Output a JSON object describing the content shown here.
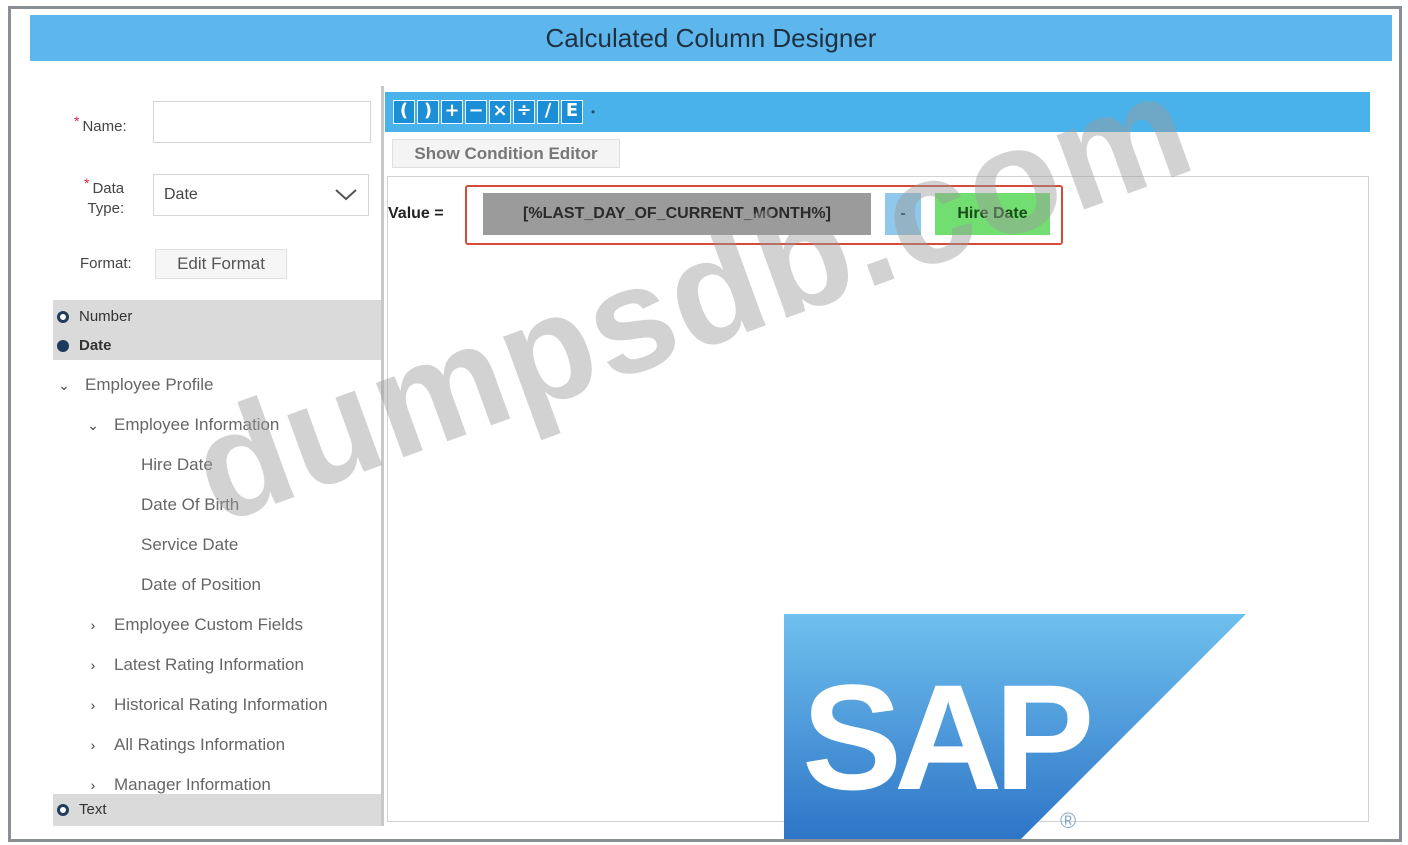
{
  "header": {
    "title": "Calculated Column Designer"
  },
  "form": {
    "name_label": "Name:",
    "data_type_label_1": "Data",
    "data_type_label_2": "Type:",
    "data_type_value": "Date",
    "format_label": "Format:",
    "edit_format_label": "Edit Format",
    "required_marker": "*"
  },
  "tree": {
    "radio_number": "Number",
    "radio_date": "Date",
    "radio_text": "Text",
    "employee_profile": "Employee Profile",
    "employee_information": "Employee Information",
    "leaf_items": [
      "Hire Date",
      "Date Of Birth",
      "Service Date",
      "Date of Position"
    ],
    "collapsed_items": [
      "Employee Custom Fields",
      "Latest Rating Information",
      "Historical Rating Information",
      "All Ratings Information",
      "Manager Information"
    ]
  },
  "toolbar": {
    "buttons": [
      "(",
      ")",
      "+",
      "−",
      "×",
      "÷",
      "∕",
      "E"
    ],
    "show_condition_editor_label": "Show Condition Editor"
  },
  "expression": {
    "value_label": "Value =",
    "variable_token": "[%LAST_DAY_OF_CURRENT_MONTH%]",
    "operator_token": "-",
    "field_token": "Hire Date"
  },
  "branding": {
    "logo_text": "SAP",
    "registered_mark": "®"
  },
  "watermark": {
    "text": "dumpsdb.com"
  },
  "colors": {
    "title_bar": "#5db7ec",
    "toolbar": "#4ab2ea",
    "variable_token": "#9b9b9b",
    "operator_token": "#8fc8ea",
    "field_token": "#72de72",
    "highlight_border": "#d44b3a"
  }
}
